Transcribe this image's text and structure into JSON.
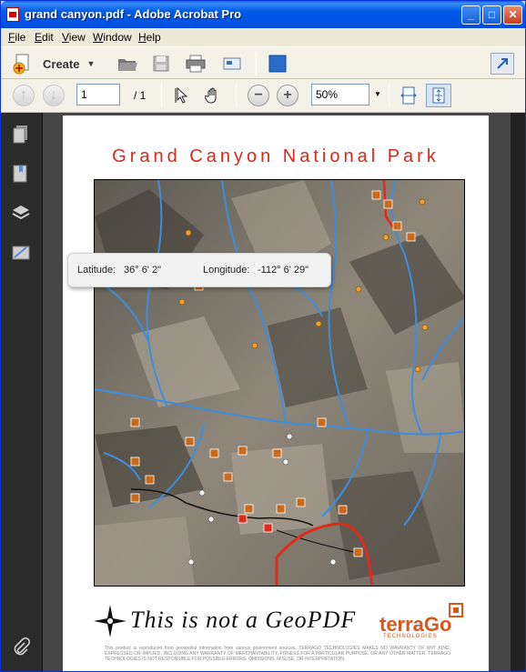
{
  "window": {
    "title": "grand canyon.pdf - Adobe Acrobat Pro",
    "buttons": {
      "minimize": "_",
      "maximize": "□",
      "close": "✕"
    }
  },
  "menu": [
    "File",
    "Edit",
    "View",
    "Window",
    "Help"
  ],
  "toolbar": {
    "create_label": "Create",
    "page_current": "1",
    "page_total": "/ 1",
    "zoom": "50%"
  },
  "document": {
    "title": "Grand Canyon National Park",
    "signature": "This is not a GeoPDF",
    "brand": "terraGo",
    "brand_sub": "TECHNOLOGIES",
    "disclaimer": "This product is reproduced from geospatial information from various government sources. TERRAGO TECHNOLOGIES MAKES NO WARRANTY OF ANY KIND, EXPRESSED OR IMPLIED, INCLUDING ANY WARRANTY OF MERCHANTABILITY, FITNESS FOR A PARTICULAR PURPOSE, OR ANY OTHER MATTER. TERRAGO TECHNOLOGIES IS NOT RESPONSIBLE FOR POSSIBLE ERRORS, OMISSIONS, MISUSE, OR INTERPRETATION."
  },
  "tooltip": {
    "lat_label": "Latitude:",
    "lat_value": "36° 6' 2\"",
    "lon_label": "Longitude:",
    "lon_value": "-112° 6' 29\""
  },
  "icons": {
    "nav": [
      "pages-icon",
      "bookmarks-icon",
      "layers-icon",
      "signatures-icon",
      "attachments-icon"
    ]
  },
  "colors": {
    "title_red": "#d9291c",
    "brand_orange": "#d9561c",
    "river_blue": "#3d8de0"
  }
}
